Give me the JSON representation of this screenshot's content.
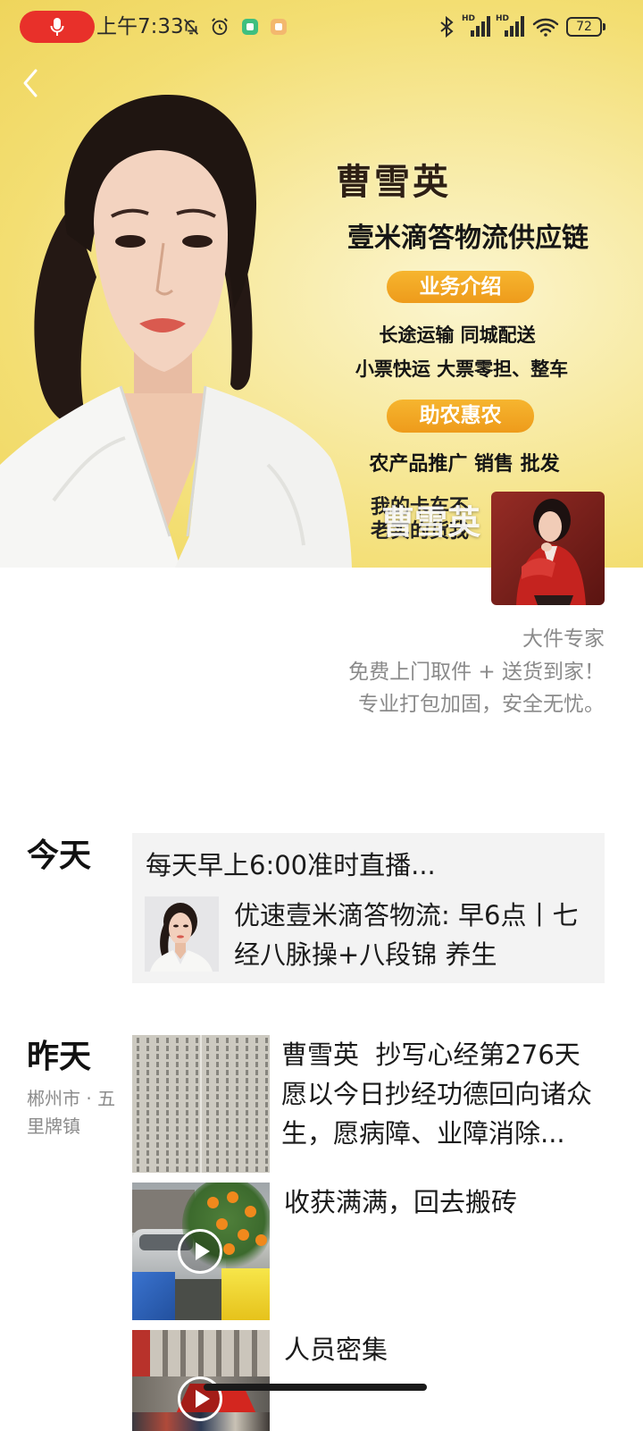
{
  "status_bar": {
    "time": "上午7:33",
    "network_1_label": "HD",
    "network_2_label": "HD",
    "battery_level": "72",
    "recording_indicator_color": "#e8302a",
    "left_icons": [
      "mic-icon",
      "bell-off-icon",
      "alarm-icon",
      "app-notification-green-icon",
      "app-notification-orange-icon"
    ],
    "right_icons": [
      "bluetooth-icon",
      "signal-icon",
      "signal-icon",
      "wifi-icon",
      "battery-icon"
    ]
  },
  "navigation": {
    "back_icon": "chevron-left-icon"
  },
  "cover": {
    "name": "曹雪英",
    "company": "壹米滴答物流供应链",
    "services": {
      "label": "业务介绍",
      "lines": [
        "长途运输 同城配送",
        "小票快运 大票零担、整车"
      ]
    },
    "agriculture": {
      "label": "助农惠农",
      "lines": [
        "农产品推广 销售 批发"
      ]
    },
    "slogan_lines": [
      "我的卡车不",
      "老实的货我"
    ],
    "badge_color": "#f2a623",
    "background_color": "#f3de72"
  },
  "profile": {
    "nickname": "曹雪英",
    "signature_lines": [
      "大件专家",
      "免费上门取件 + 送货到家！",
      "专业打包加固，安全无忧。"
    ]
  },
  "moments": {
    "today": {
      "day_label": "今天",
      "post": {
        "text": "每天早上6:00准时直播...",
        "shared_link_title": "优速壹米滴答物流: 早6点丨七经八脉操+八段锦 养生"
      }
    },
    "yesterday": {
      "day_label": "昨天",
      "location": "郴州市 · 五里牌镇",
      "posts": [
        {
          "text": "曹雪英  抄写心经第276天\n愿以今日抄经功德回向诸众生，愿病障、业障消除..."
        },
        {
          "text": "收获满满，回去搬砖",
          "media_icon": "play-icon"
        },
        {
          "text": "人员密集",
          "media_icon": "play-icon"
        }
      ]
    }
  }
}
